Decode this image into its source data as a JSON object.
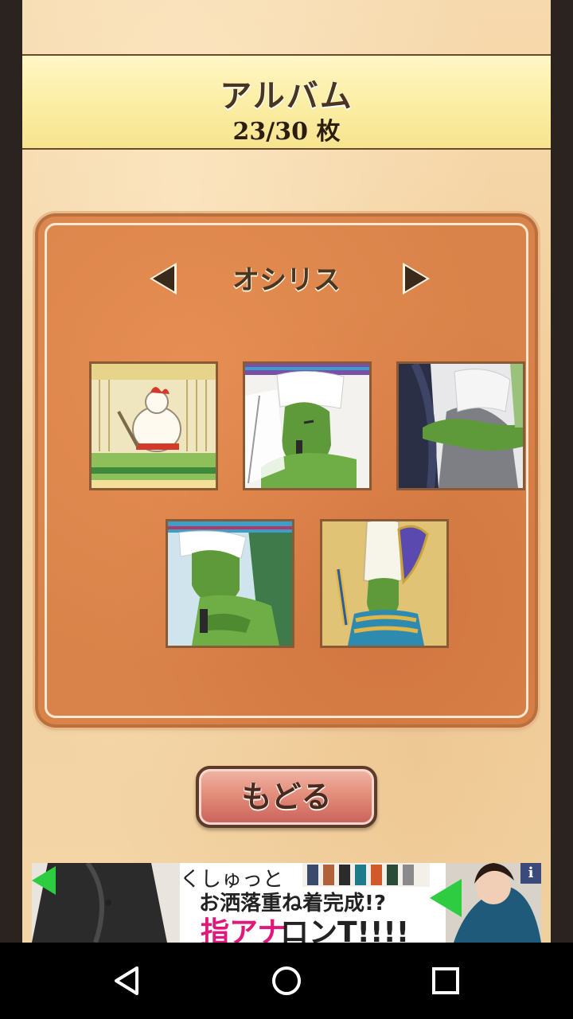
{
  "header": {
    "title": "アルバム",
    "count": "23/30 枚"
  },
  "album": {
    "god_name": "オシリス",
    "prev_icon": "triangle-left-icon",
    "next_icon": "triangle-right-icon",
    "thumbnails": [
      "rooster-in-palace-thumbnail",
      "osiris-profile-thumbnail",
      "embrace-thumbnail",
      "osiris-leaning-thumbnail",
      "osiris-pharaoh-thumbnail"
    ]
  },
  "buttons": {
    "back_label": "もどる"
  },
  "ad": {
    "line1": "くしゅっと",
    "line2": "お洒落重ね着完成!?",
    "line3_pink": "指アナ",
    "line3_black": "ロンT!!!!",
    "info_label": "i"
  },
  "navbar": {
    "back_icon": "back-triangle-icon",
    "home_icon": "home-circle-icon",
    "recents_icon": "recents-square-icon"
  },
  "colors": {
    "header_bg": "#fcefa8",
    "panel_bg": "#d9834a",
    "button_bg": "#e38e7b",
    "page_bg": "#f2cf9c"
  }
}
